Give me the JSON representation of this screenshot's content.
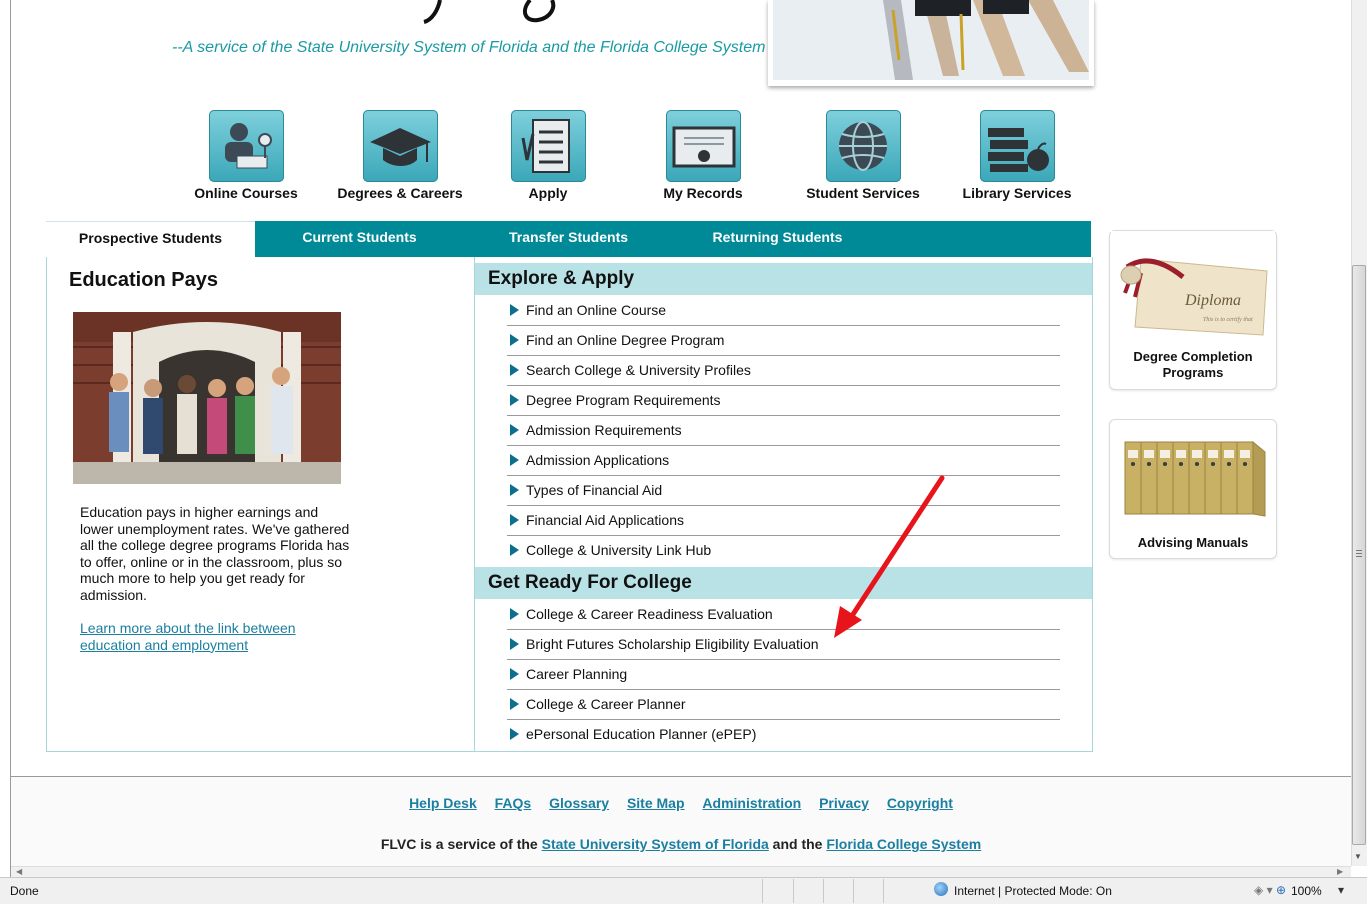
{
  "header": {
    "tagline": "--A service of the State University System of Florida and the Florida College System"
  },
  "nav": {
    "items": [
      {
        "label": "Online Courses",
        "icon": "online-courses-icon"
      },
      {
        "label": "Degrees & Careers",
        "icon": "graduation-cap-icon"
      },
      {
        "label": "Apply",
        "icon": "checklist-icon"
      },
      {
        "label": "My Records",
        "icon": "certificate-icon"
      },
      {
        "label": "Student Services",
        "icon": "globe-icon"
      },
      {
        "label": "Library Services",
        "icon": "books-apple-icon"
      }
    ]
  },
  "tabs": [
    {
      "label": "Prospective Students",
      "active": true
    },
    {
      "label": "Current Students",
      "active": false
    },
    {
      "label": "Transfer Students",
      "active": false
    },
    {
      "label": "Returning Students",
      "active": false
    }
  ],
  "education_pays": {
    "title": "Education Pays",
    "body": "Education pays in higher earnings and lower unemployment rates. We've gathered all the college degree programs Florida has to offer, online or in the classroom, plus so much more to help you get ready for admission.",
    "link": "Learn more about the link between education and employment"
  },
  "explore": {
    "heading": "Explore & Apply",
    "links": [
      "Find an Online Course",
      "Find an Online Degree Program",
      "Search College & University Profiles",
      "Degree Program Requirements",
      "Admission Requirements",
      "Admission Applications",
      "Types of Financial Aid",
      "Financial Aid Applications",
      "College & University Link Hub"
    ]
  },
  "get_ready": {
    "heading": "Get Ready For College",
    "links": [
      "College & Career Readiness Evaluation",
      "Bright Futures Scholarship Eligibility Evaluation",
      "Career Planning",
      "College & Career Planner",
      "ePersonal Education Planner (ePEP)"
    ]
  },
  "side": {
    "degree_completion": "Degree Completion Programs",
    "diploma_image_text": "Diploma",
    "diploma_subtext": "This is to certify that",
    "advising": "Advising Manuals"
  },
  "footer": {
    "links": [
      "Help Desk",
      "FAQs",
      "Glossary",
      "Site Map",
      "Administration",
      "Privacy",
      "Copyright"
    ],
    "service_prefix": "FLVC is a service of the ",
    "service_link1": "State University System of Florida",
    "service_middle": " and the ",
    "service_link2": "Florida College System"
  },
  "status": {
    "left": "Done",
    "zone": "Internet | Protected Mode: On",
    "zoom": "100%"
  },
  "colors": {
    "teal": "#008a97",
    "light_teal": "#b9e2e7",
    "link": "#1a7fa0",
    "arrow": "#e8141b"
  }
}
